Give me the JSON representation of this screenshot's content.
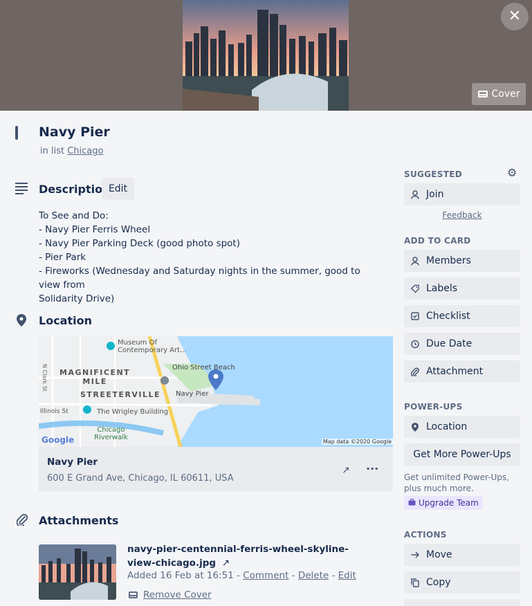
{
  "cover": {
    "button_label": "Cover",
    "close_glyph": "✕"
  },
  "card": {
    "title": "Navy Pier",
    "in_list_prefix": "in list",
    "list_name": "Chicago"
  },
  "description": {
    "heading": "Description",
    "edit_label": "Edit",
    "lines": [
      "To See and Do:",
      "- Navy Pier Ferris Wheel",
      "- Navy Pier Parking Deck (good photo spot)",
      "- Pier Park",
      "- Fireworks (Wednesday and Saturday nights in the summer, good to view from",
      "Solidarity Drive)"
    ]
  },
  "location": {
    "heading": "Location",
    "map": {
      "labels": [
        "Museum Of",
        "Contemporary Art...",
        "MAGNIFICENT",
        "MILE",
        "Ohio Street Beach",
        "Navy Pier",
        "STREETERVILLE",
        "Illinois St",
        "The Wrigley Building",
        "Chicago",
        "Riverwalk",
        "N Clark St",
        "Google",
        "Map data ©2020 Google"
      ]
    },
    "name": "Navy Pier",
    "address": "600 E Grand Ave, Chicago, IL 60611, USA",
    "open_glyph": "↗",
    "more_glyph": "···"
  },
  "attachments": {
    "heading": "Attachments",
    "file_name": "navy-pier-centennial-ferris-wheel-skyline-view-chicago.jpg",
    "open_glyph": "↗",
    "added": "Added 16 Feb at 16:51",
    "sep": " - ",
    "comment": "Comment",
    "delete": "Delete",
    "edit": "Edit",
    "remove_cover": "Remove Cover"
  },
  "sidebar": {
    "suggested": {
      "heading": "SUGGESTED",
      "join": "Join",
      "feedback": "Feedback"
    },
    "add_to_card": {
      "heading": "ADD TO CARD",
      "items": [
        "Members",
        "Labels",
        "Checklist",
        "Due Date",
        "Attachment"
      ]
    },
    "power_ups": {
      "heading": "POWER-UPS",
      "location": "Location",
      "more": "Get More Power-Ups",
      "note": "Get unlimited Power-Ups, plus much more.",
      "upgrade": "Upgrade Team"
    },
    "actions": {
      "heading": "ACTIONS",
      "items": [
        "Move",
        "Copy"
      ]
    }
  },
  "colors": {
    "cover_bg": "#6f6562",
    "panel_bg": "#f4f5f7",
    "button_bg": "#e9ebee",
    "map_water": "#aadaff",
    "upgrade_bg": "#eae6ff"
  }
}
